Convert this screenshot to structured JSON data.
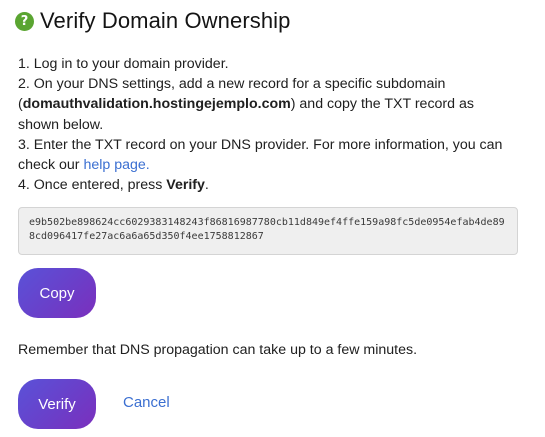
{
  "header": {
    "title": "Verify Domain Ownership",
    "icon": "help-circle-icon",
    "icon_glyph": "?",
    "icon_color": "#5aa531"
  },
  "steps": {
    "step1": "1. Log in to your domain provider.",
    "step2_prefix": "2. On your DNS settings, add a new record for a specific subdomain (",
    "step2_domain": "domauthvalidation.hostingejemplo.com",
    "step2_suffix": ") and copy the TXT record as shown below.",
    "step3_prefix": "3. Enter the TXT record on your DNS provider. For more information, you can check our ",
    "step3_link": "help page.",
    "step4_prefix": "4. Once entered, press ",
    "step4_bold": "Verify",
    "step4_suffix": "."
  },
  "txt_record": "e9b502be898624cc6029383148243f86816987780cb11d849ef4ffe159a98fc5de0954efab4de898cd096417fe27ac6a6a65d350f4ee1758812867",
  "actions": {
    "copy_label": "Copy",
    "verify_label": "Verify",
    "cancel_label": "Cancel"
  },
  "notice": "Remember that DNS propagation can take up to a few minutes.",
  "colors": {
    "button_gradient_start": "#5a52d8",
    "button_gradient_end": "#7b2fbd",
    "link": "#3b6fd1"
  }
}
